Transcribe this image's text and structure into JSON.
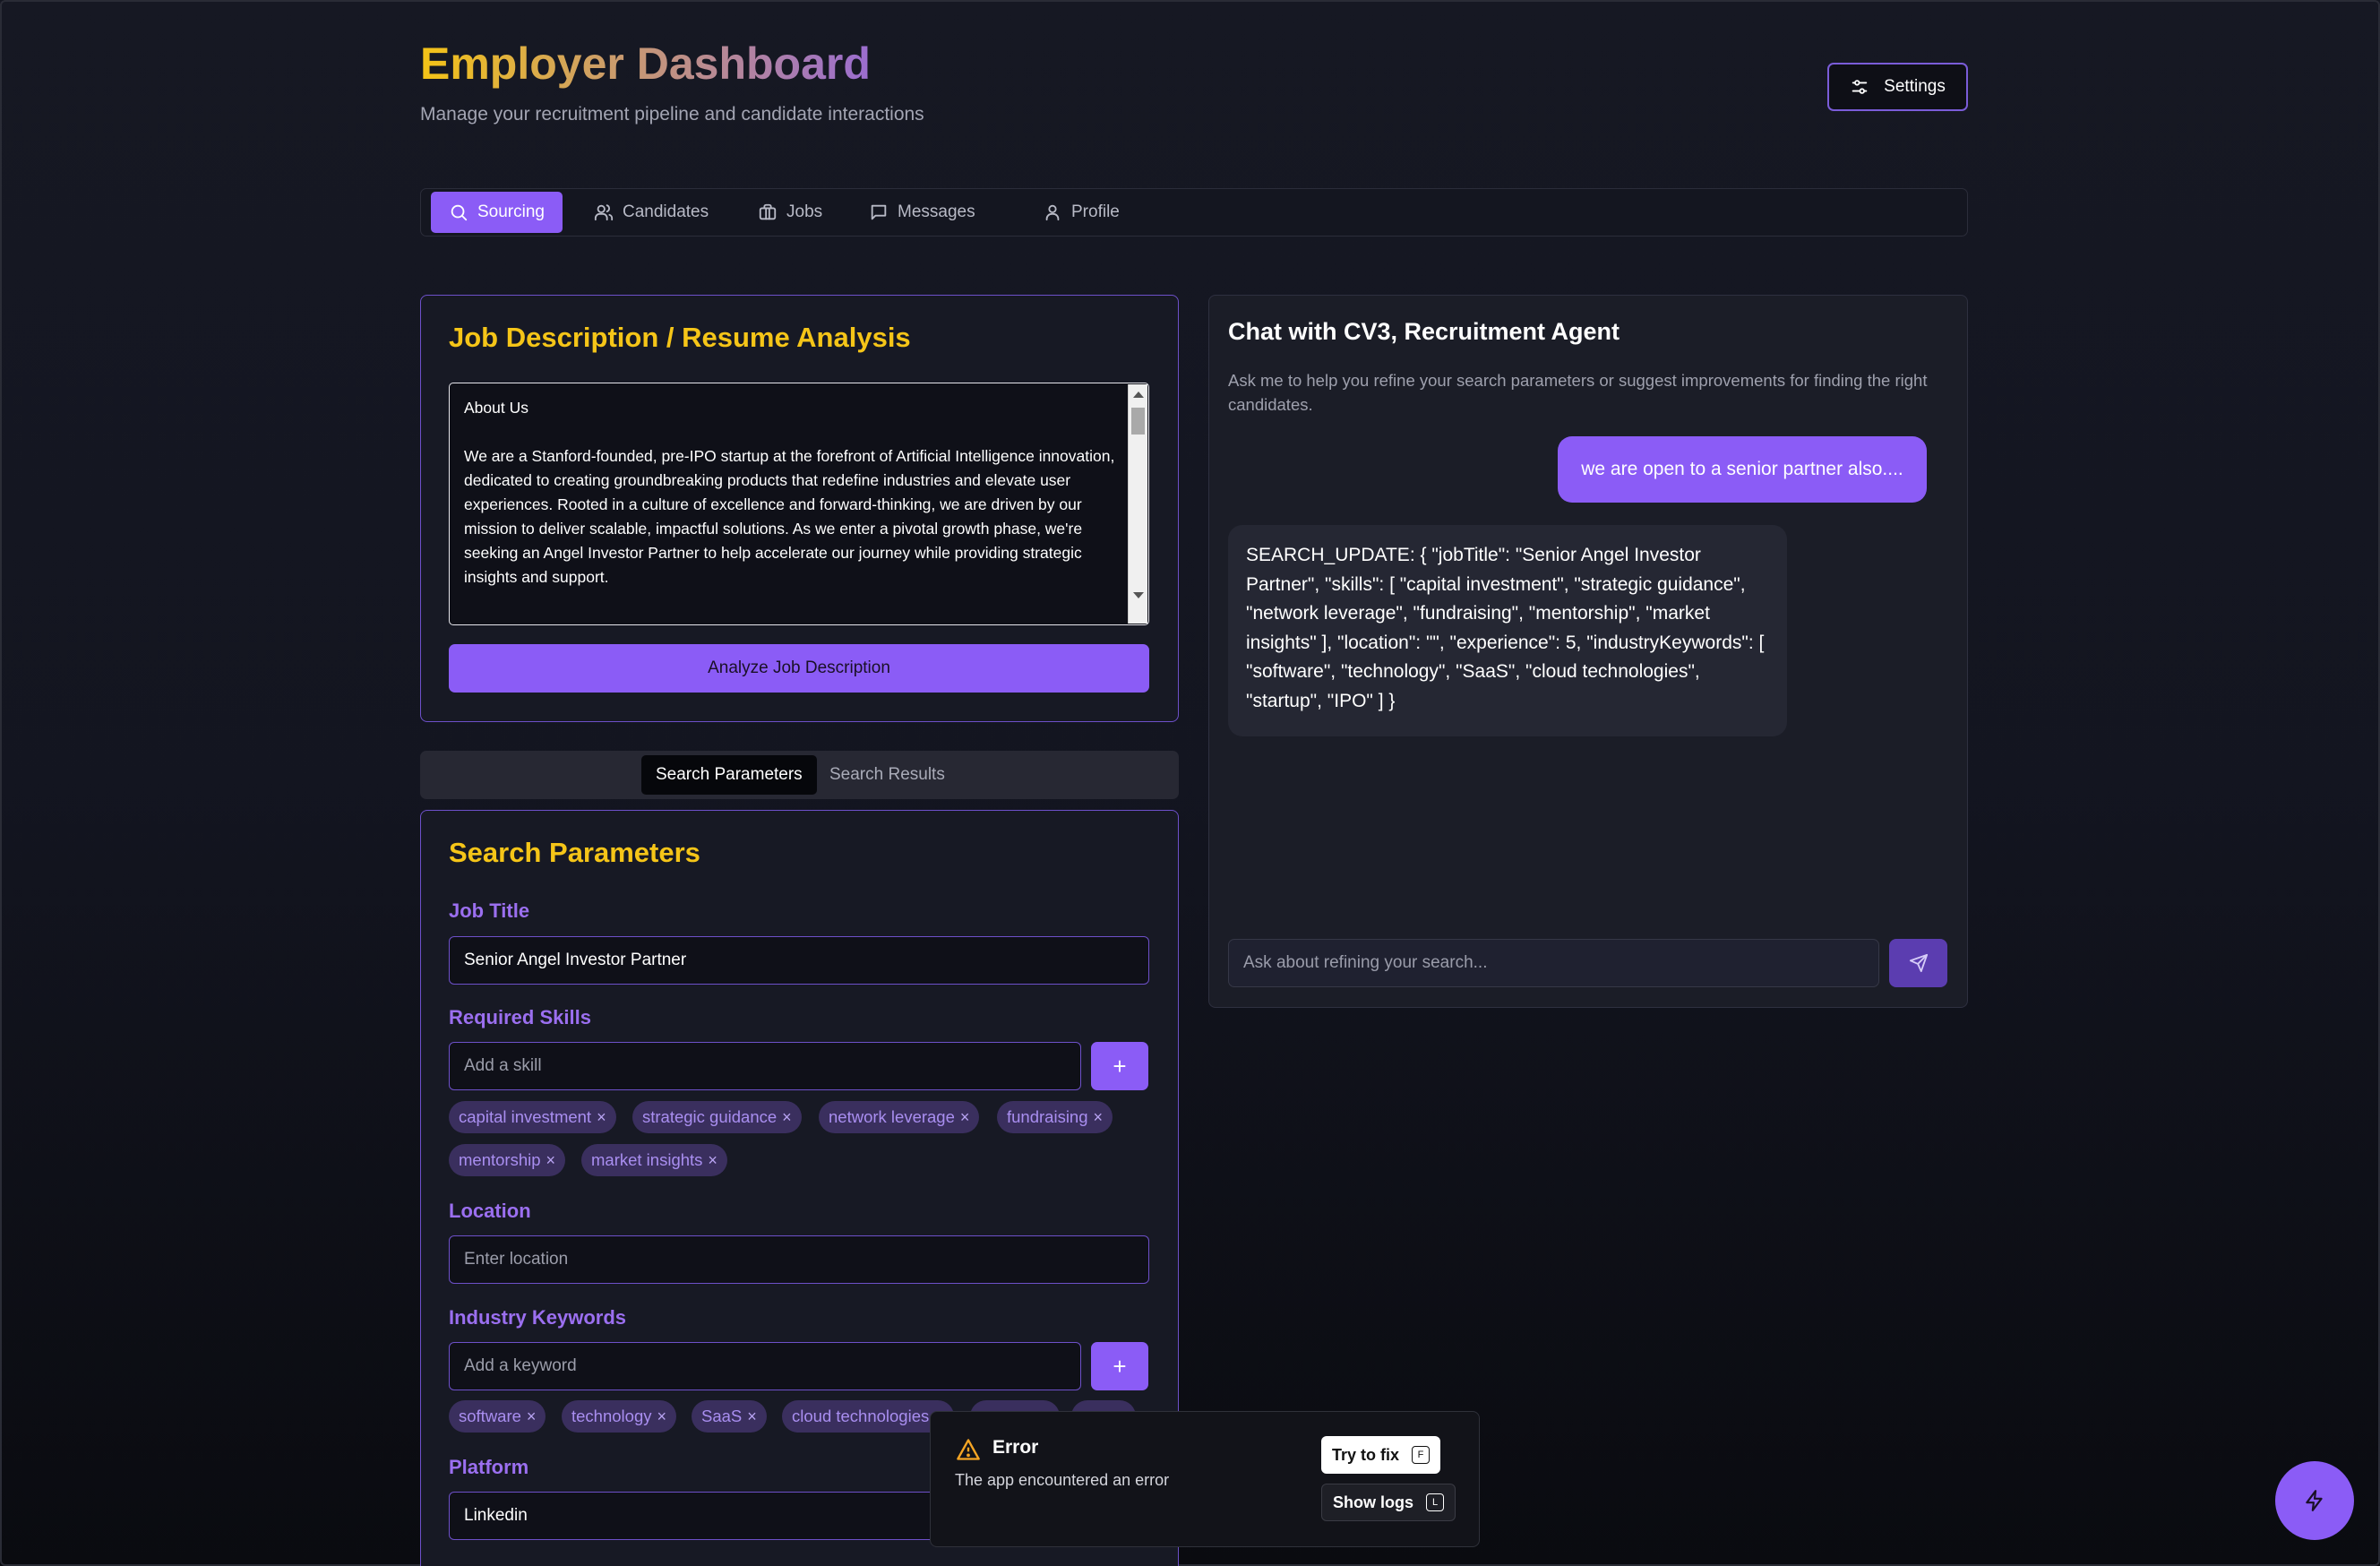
{
  "header": {
    "title": "Employer Dashboard",
    "subtitle": "Manage your recruitment pipeline and candidate interactions",
    "settings_label": "Settings"
  },
  "tabs": [
    {
      "label": "Sourcing",
      "icon": "search-icon",
      "active": true
    },
    {
      "label": "Candidates",
      "icon": "users-icon",
      "active": false
    },
    {
      "label": "Jobs",
      "icon": "briefcase-icon",
      "active": false
    },
    {
      "label": "Messages",
      "icon": "message-icon",
      "active": false
    },
    {
      "label": "Profile",
      "icon": "user-icon",
      "active": false
    }
  ],
  "analysis": {
    "title": "Job Description / Resume Analysis",
    "text_heading": "About Us",
    "text_body": "We are a Stanford-founded, pre-IPO startup at the forefront of Artificial Intelligence innovation, dedicated to creating groundbreaking products that redefine industries and elevate user experiences. Rooted in a culture of excellence and forward-thinking, we are driven by our mission to deliver scalable, impactful solutions. As we enter a pivotal growth phase, we're seeking an Angel Investor Partner to help accelerate our journey while providing strategic insights and support.",
    "button_label": "Analyze Job Description"
  },
  "subtabs": [
    {
      "label": "Search Parameters",
      "active": true
    },
    {
      "label": "Search Results",
      "active": false
    }
  ],
  "search_params": {
    "title": "Search Parameters",
    "job_title_label": "Job Title",
    "job_title_value": "Senior Angel Investor Partner",
    "skills_label": "Required Skills",
    "skills_placeholder": "Add a skill",
    "skills": [
      "capital investment",
      "strategic guidance",
      "network leverage",
      "fundraising",
      "mentorship",
      "market insights"
    ],
    "location_label": "Location",
    "location_placeholder": "Enter location",
    "keywords_label": "Industry Keywords",
    "keywords_placeholder": "Add a keyword",
    "keywords": [
      "software",
      "technology",
      "SaaS",
      "cloud technologies"
    ],
    "platform_label": "Platform",
    "platform_value": "Linkedin",
    "add_symbol": "+",
    "remove_symbol": "×"
  },
  "chat": {
    "title": "Chat with CV3, Recruitment Agent",
    "description": "Ask me to help you refine your search parameters or suggest improvements for finding the right candidates.",
    "user_message": "we are open to a senior partner also....",
    "agent_message": "SEARCH_UPDATE: { \"jobTitle\": \"Senior Angel Investor Partner\", \"skills\": [ \"capital investment\", \"strategic guidance\", \"network leverage\", \"fundraising\", \"mentorship\", \"market insights\" ], \"location\": \"\", \"experience\": 5, \"industryKeywords\": [ \"software\", \"technology\", \"SaaS\", \"cloud technologies\", \"startup\", \"IPO\" ] }",
    "input_placeholder": "Ask about refining your search..."
  },
  "error_toast": {
    "title": "Error",
    "message": "The app encountered an error",
    "fix_label": "Try to fix",
    "fix_key": "F",
    "logs_label": "Show logs",
    "logs_key": "L"
  },
  "colors": {
    "accent": "#8b5cf6",
    "heading_yellow": "#f5c518",
    "background": "#161823"
  }
}
